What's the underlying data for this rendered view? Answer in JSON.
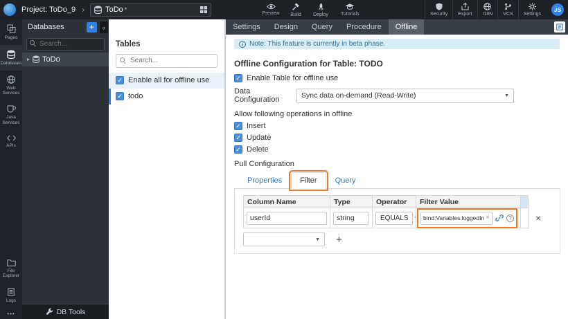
{
  "colors": {
    "accent": "#2f80e7",
    "annotation": "#e87b2a",
    "banner-bg": "#d9edf7",
    "banner-text": "#31708f"
  },
  "glyphs": {
    "chevron": "›",
    "collapse": "«",
    "tree_caret": "▸",
    "caret_down": "▼",
    "close": "×",
    "plus": "+",
    "question": "?",
    "info": "i",
    "more": "•••"
  },
  "topbar": {
    "project_label": "Project: ToDo_9",
    "entity_name": "ToDo",
    "entity_dirty": "*",
    "actions": [
      {
        "label": "Preview",
        "icon": "eye-icon"
      },
      {
        "label": "Build",
        "icon": "hammer-icon"
      },
      {
        "label": "Deploy",
        "icon": "rocket-icon"
      }
    ],
    "tutorials": {
      "label": "Tutorials",
      "icon": "graduation-cap-icon"
    },
    "utilities": [
      {
        "label": "Security",
        "icon": "shield-icon"
      },
      {
        "label": "Export",
        "icon": "export-icon"
      },
      {
        "label": "I18N",
        "icon": "globe-icon"
      },
      {
        "label": "VCS",
        "icon": "branch-icon"
      },
      {
        "label": "Settings",
        "icon": "gear-icon"
      }
    ],
    "avatar_initials": "JS"
  },
  "rail": {
    "items": [
      {
        "label": "Pages",
        "icon": "pages-icon",
        "active": false
      },
      {
        "label": "Databases",
        "icon": "database-icon",
        "active": true
      },
      {
        "label": "Web Services",
        "icon": "web-services-icon",
        "active": false
      },
      {
        "label": "Java Services",
        "icon": "java-services-icon",
        "active": false
      },
      {
        "label": "APIs",
        "icon": "api-icon",
        "active": false
      }
    ],
    "bottom_items": [
      {
        "label": "File Explorer",
        "icon": "folder-icon"
      },
      {
        "label": "Logs",
        "icon": "logs-icon"
      }
    ]
  },
  "db_panel": {
    "title": "Databases",
    "search_placeholder": "Search...",
    "items": [
      {
        "label": "ToDo",
        "selected": true
      }
    ],
    "footer": "DB Tools"
  },
  "tables_panel": {
    "title": "Tables",
    "search_placeholder": "Search...",
    "enable_all": {
      "label": "Enable all for offline use",
      "checked": true
    },
    "tables": [
      {
        "label": "todo",
        "checked": true,
        "selected": true
      }
    ]
  },
  "workspace_tabs": {
    "items": [
      "Settings",
      "Design",
      "Query",
      "Procedure",
      "Offline"
    ],
    "active": "Offline"
  },
  "offline": {
    "note": "Note: This feature is currently in beta phase.",
    "title": "Offline Configuration for Table: TODO",
    "enable_table": {
      "label": "Enable Table for offline use",
      "checked": true
    },
    "data_configuration": {
      "label": "Data Configuration",
      "value": "Sync data on-demand (Read-Write)"
    },
    "operations_label": "Allow following operations in offline",
    "operations": [
      {
        "label": "Insert",
        "checked": true
      },
      {
        "label": "Update",
        "checked": true
      },
      {
        "label": "Delete",
        "checked": true
      }
    ],
    "pull_label": "Pull Configuration",
    "pull_tabs": {
      "items": [
        "Properties",
        "Filter",
        "Query"
      ],
      "active": "Filter"
    },
    "filter_table": {
      "headers": [
        "Column Name",
        "Type",
        "Operator",
        "Filter Value"
      ],
      "rows": [
        {
          "column_name": "userId",
          "type": "string",
          "operator": "EQUALS",
          "filter_value": "bind:Variables.loggedInUser.data"
        }
      ]
    }
  }
}
